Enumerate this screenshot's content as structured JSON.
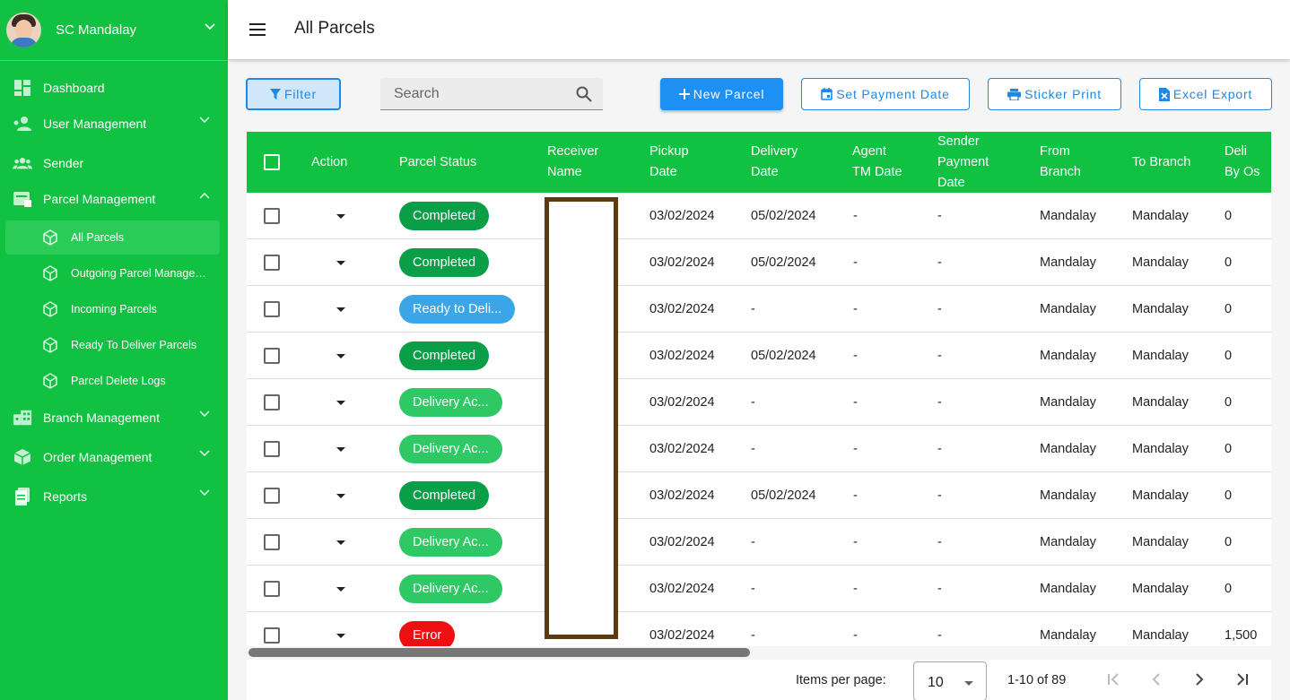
{
  "colors": {
    "sidebar": "#11c142",
    "accent": "#1e88e5",
    "completed": "#0a9e46",
    "ready": "#3aa6e8",
    "delivery_accepted": "#2ec864",
    "error": "#ee1010"
  },
  "sidebar": {
    "user_name": "SC Mandalay",
    "items": [
      {
        "label": "Dashboard",
        "icon": "dashboard-icon"
      },
      {
        "label": "User Management",
        "icon": "users-icon"
      },
      {
        "label": "Sender",
        "icon": "group-icon"
      },
      {
        "label": "Parcel Management",
        "icon": "parcel-icon"
      },
      {
        "label": "Branch Management",
        "icon": "branch-icon"
      },
      {
        "label": "Order Management",
        "icon": "order-icon"
      },
      {
        "label": "Reports",
        "icon": "reports-icon"
      }
    ],
    "sub_items": [
      {
        "label": "All Parcels"
      },
      {
        "label": "Outgoing Parcel Management"
      },
      {
        "label": "Incoming Parcels"
      },
      {
        "label": "Ready To Deliver Parcels"
      },
      {
        "label": "Parcel Delete Logs"
      }
    ]
  },
  "header": {
    "title": "All Parcels"
  },
  "toolbar": {
    "filter_label": "Filter",
    "search_placeholder": "Search",
    "new_parcel_label": "New Parcel",
    "set_payment_label": "Set Payment Date",
    "sticker_label": "Sticker Print",
    "excel_label": "Excel Export"
  },
  "table": {
    "headers": [
      "Action",
      "Parcel Status",
      "Receiver Name",
      "Pickup Date",
      "Delivery Date",
      "Agent TM Date",
      "Sender Payment Date",
      "From Branch",
      "To Branch",
      "Deli By Os"
    ],
    "rows": [
      {
        "status": "Completed",
        "status_type": "completed",
        "pickup": "03/02/2024",
        "delivery": "05/02/2024",
        "agent": "-",
        "payment": "-",
        "from": "Mandalay",
        "to": "Mandalay",
        "deli": "0"
      },
      {
        "status": "Completed",
        "status_type": "completed",
        "pickup": "03/02/2024",
        "delivery": "05/02/2024",
        "agent": "-",
        "payment": "-",
        "from": "Mandalay",
        "to": "Mandalay",
        "deli": "0"
      },
      {
        "status": "Ready to Deli...",
        "status_type": "ready",
        "pickup": "03/02/2024",
        "delivery": "-",
        "agent": "-",
        "payment": "-",
        "from": "Mandalay",
        "to": "Mandalay",
        "deli": "0"
      },
      {
        "status": "Completed",
        "status_type": "completed",
        "pickup": "03/02/2024",
        "delivery": "05/02/2024",
        "agent": "-",
        "payment": "-",
        "from": "Mandalay",
        "to": "Mandalay",
        "deli": "0"
      },
      {
        "status": "Delivery Ac...",
        "status_type": "delivery_accepted",
        "pickup": "03/02/2024",
        "delivery": "-",
        "agent": "-",
        "payment": "-",
        "from": "Mandalay",
        "to": "Mandalay",
        "deli": "0"
      },
      {
        "status": "Delivery Ac...",
        "status_type": "delivery_accepted",
        "pickup": "03/02/2024",
        "delivery": "-",
        "agent": "-",
        "payment": "-",
        "from": "Mandalay",
        "to": "Mandalay",
        "deli": "0"
      },
      {
        "status": "Completed",
        "status_type": "completed",
        "pickup": "03/02/2024",
        "delivery": "05/02/2024",
        "agent": "-",
        "payment": "-",
        "from": "Mandalay",
        "to": "Mandalay",
        "deli": "0"
      },
      {
        "status": "Delivery Ac...",
        "status_type": "delivery_accepted",
        "pickup": "03/02/2024",
        "delivery": "-",
        "agent": "-",
        "payment": "-",
        "from": "Mandalay",
        "to": "Mandalay",
        "deli": "0"
      },
      {
        "status": "Delivery Ac...",
        "status_type": "delivery_accepted",
        "pickup": "03/02/2024",
        "delivery": "-",
        "agent": "-",
        "payment": "-",
        "from": "Mandalay",
        "to": "Mandalay",
        "deli": "0"
      },
      {
        "status": "Error",
        "status_type": "error",
        "pickup": "03/02/2024",
        "delivery": "-",
        "agent": "-",
        "payment": "-",
        "from": "Mandalay",
        "to": "Mandalay",
        "deli": "1,500"
      }
    ]
  },
  "paginator": {
    "items_per_page_label": "Items per page:",
    "items_per_page": "10",
    "range": "1-10 of 89"
  }
}
